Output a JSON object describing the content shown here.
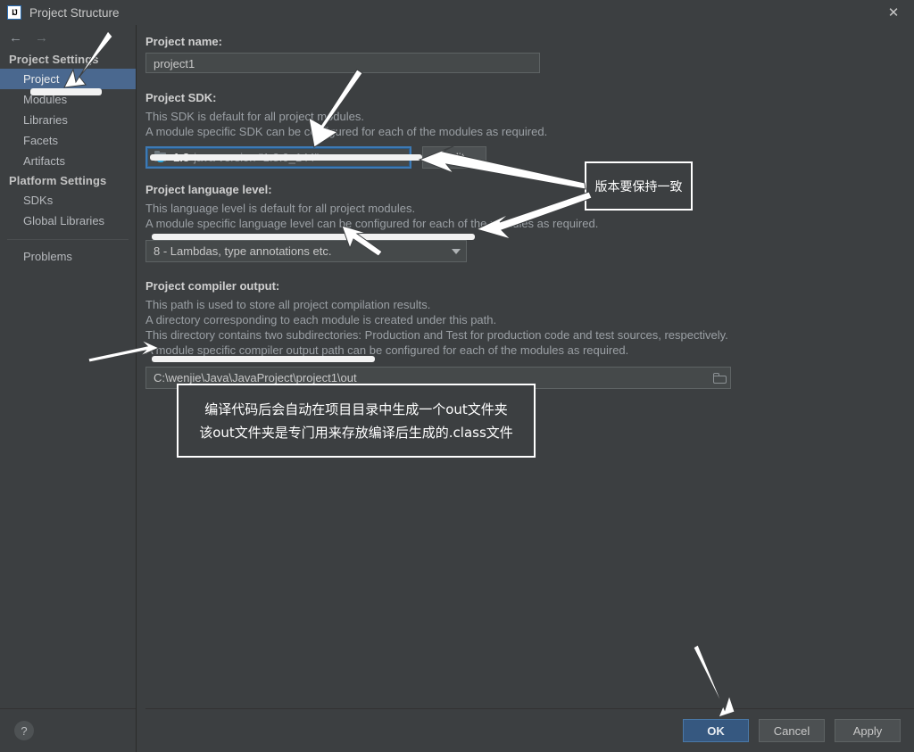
{
  "window": {
    "title": "Project Structure",
    "app_icon": "intellij-idea-icon",
    "close_icon": "close-icon",
    "back_icon": "back-arrow-icon",
    "forward_icon": "forward-arrow-icon"
  },
  "sidebar": {
    "groups": [
      {
        "header": "Project Settings",
        "items": [
          {
            "label": "Project",
            "selected": true
          },
          {
            "label": "Modules",
            "selected": false
          },
          {
            "label": "Libraries",
            "selected": false
          },
          {
            "label": "Facets",
            "selected": false
          },
          {
            "label": "Artifacts",
            "selected": false
          }
        ]
      },
      {
        "header": "Platform Settings",
        "items": [
          {
            "label": "SDKs",
            "selected": false
          },
          {
            "label": "Global Libraries",
            "selected": false
          }
        ]
      }
    ],
    "extra_items": [
      {
        "label": "Problems"
      }
    ],
    "help_label": "?"
  },
  "main": {
    "project_name": {
      "label": "Project name:",
      "value": "project1",
      "placeholder": "project1"
    },
    "project_sdk": {
      "label": "Project SDK:",
      "desc_lines": [
        "This SDK is default for all project modules.",
        "A module specific SDK can be configured for each of the modules as required."
      ],
      "selected_version": "1.8",
      "selected_detail": "java version \"1.8.0_144\"",
      "edit_label": "Edit",
      "icon": "java-sdk-icon",
      "caret_icon": "chevron-down-icon"
    },
    "language_level": {
      "label": "Project language level:",
      "desc_lines": [
        "This language level is default for all project modules.",
        "A module specific language level can be configured for each of the modules as required."
      ],
      "selected": "8 - Lambdas, type annotations etc.",
      "caret_icon": "chevron-down-icon"
    },
    "compiler_output": {
      "label": "Project compiler output:",
      "desc_lines": [
        "This path is used to store all project compilation results.",
        "A directory corresponding to each module is created under this path.",
        "This directory contains two subdirectories: Production and Test for production code and test sources, respectively.",
        "A module specific compiler output path can be configured for each of the modules as required."
      ],
      "value": "C:\\wenjie\\Java\\JavaProject\\project1\\out",
      "browse_icon": "folder-browse-icon"
    }
  },
  "footer": {
    "ok_label": "OK",
    "cancel_label": "Cancel",
    "apply_label": "Apply"
  },
  "annotations": {
    "version_note": "版本要保持一致",
    "out_note_line1": "编译代码后会自动在项目目录中生成一个out文件夹",
    "out_note_line2": "该out文件夹是专门用来存放编译后生成的.class文件"
  },
  "colors": {
    "background": "#3c3f41",
    "selection": "#4a688f",
    "ok_button": "#365880",
    "focus_border": "#3d7ab5",
    "annotation": "#ffffff"
  }
}
